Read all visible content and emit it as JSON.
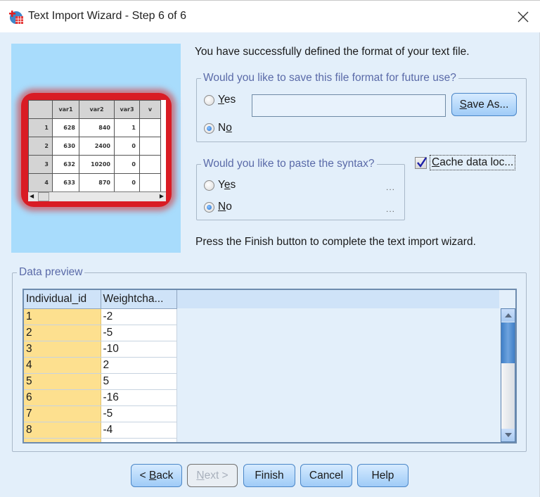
{
  "window": {
    "title": "Text Import Wizard - Step 6 of 6",
    "icon": "spss-data-icon",
    "close_icon": "close-icon"
  },
  "illustration": {
    "columns": [
      "",
      "var1",
      "var2",
      "var3",
      "v"
    ],
    "rows": [
      [
        "1",
        "628",
        "840",
        "1",
        ""
      ],
      [
        "2",
        "630",
        "2400",
        "0",
        ""
      ],
      [
        "3",
        "632",
        "10200",
        "0",
        ""
      ],
      [
        "4",
        "633",
        "870",
        "0",
        ""
      ]
    ]
  },
  "intro_text": "You have successfully defined the format of your text file.",
  "save_format": {
    "legend": "Would you like to save this file format for future use?",
    "yes_label_u": "Y",
    "yes_label_rest": "es",
    "no_label_pre": "N",
    "no_label_u": "o",
    "selected": "No",
    "path_value": "",
    "save_as_u": "S",
    "save_as_rest": "ave As..."
  },
  "paste_syntax": {
    "legend": "Would you like to paste the syntax?",
    "yes_pre": "Y",
    "yes_u": "e",
    "yes_rest": "s",
    "no_u": "N",
    "no_rest": "o",
    "selected": "No",
    "ellipsis": "..."
  },
  "cache_data": {
    "checked": true,
    "label_u": "C",
    "label_rest": "ache data loc..."
  },
  "finish_text": "Press the Finish button to complete the text import wizard.",
  "data_preview": {
    "legend": "Data preview",
    "columns": [
      "Individual_id",
      "Weightcha..."
    ],
    "rows": [
      [
        "1",
        "-2"
      ],
      [
        "2",
        "-5"
      ],
      [
        "3",
        "-10"
      ],
      [
        "4",
        "2"
      ],
      [
        "5",
        "5"
      ],
      [
        "6",
        "-16"
      ],
      [
        "7",
        "-5"
      ],
      [
        "8",
        "-4"
      ]
    ]
  },
  "buttons": {
    "back_pre": "< ",
    "back_u": "B",
    "back_rest": "ack",
    "next_u": "N",
    "next_rest": "ext >",
    "finish": "Finish",
    "cancel": "Cancel",
    "help": "Help"
  },
  "colors": {
    "accent": "#4a86c7",
    "legend_text": "#5a6aa8",
    "key_column": "#fde08f",
    "illustration_bg": "#a8dcfc",
    "illustration_frame": "#d91c24"
  }
}
